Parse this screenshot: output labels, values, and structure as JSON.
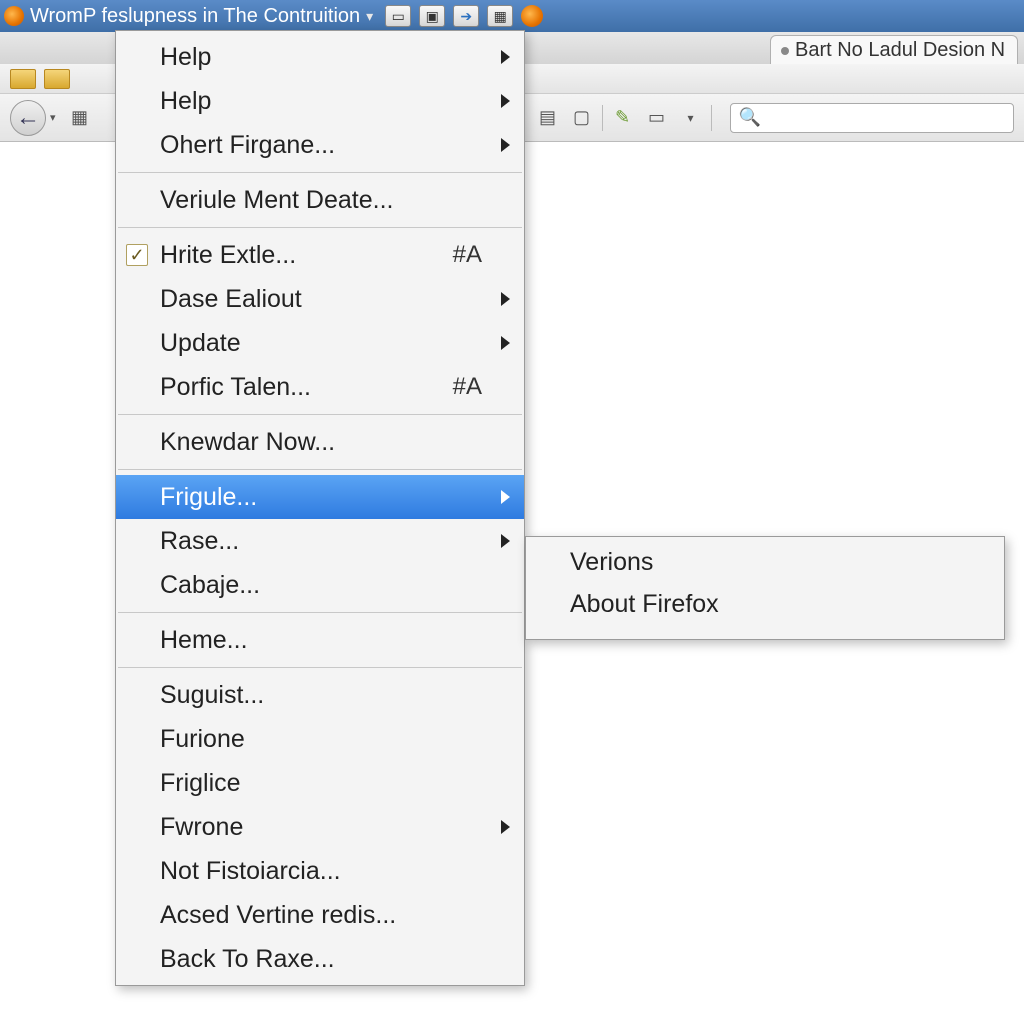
{
  "titlebar": {
    "title": "WromP feslupness in The Contruition"
  },
  "tab": {
    "label": "Bart No Ladul Desion N"
  },
  "search": {
    "placeholder": ""
  },
  "menu": {
    "items": [
      {
        "label": "Help",
        "arrow": true
      },
      {
        "label": "Help",
        "arrow": true
      },
      {
        "label": "Ohert Firgane...",
        "arrow": true
      },
      {
        "sep": true
      },
      {
        "label": "Veriule Ment Deate..."
      },
      {
        "sep": true
      },
      {
        "label": "Hrite Extle...",
        "check": true,
        "accel": "#A"
      },
      {
        "label": "Dase Ealiout",
        "arrow": true
      },
      {
        "label": "Update",
        "arrow": true
      },
      {
        "label": "Porfic Talen...",
        "accel": "#A"
      },
      {
        "sep": true
      },
      {
        "label": "Knewdar Now..."
      },
      {
        "sep": true
      },
      {
        "label": "Frigule...",
        "arrow": true,
        "highlight": true
      },
      {
        "label": "Rase...",
        "arrow": true
      },
      {
        "label": "Cabaje..."
      },
      {
        "sep": true
      },
      {
        "label": "Heme..."
      },
      {
        "sep": true
      },
      {
        "label": "Suguist..."
      },
      {
        "label": "Furione"
      },
      {
        "label": "Friglice"
      },
      {
        "label": "Fwrone",
        "arrow": true
      },
      {
        "label": "Not Fistoiarcia..."
      },
      {
        "label": "Acsed Vertine redis..."
      },
      {
        "label": "Back To Raxe..."
      }
    ]
  },
  "submenu": {
    "items": [
      {
        "label": "Verions"
      },
      {
        "label": "About Firefox"
      }
    ]
  }
}
